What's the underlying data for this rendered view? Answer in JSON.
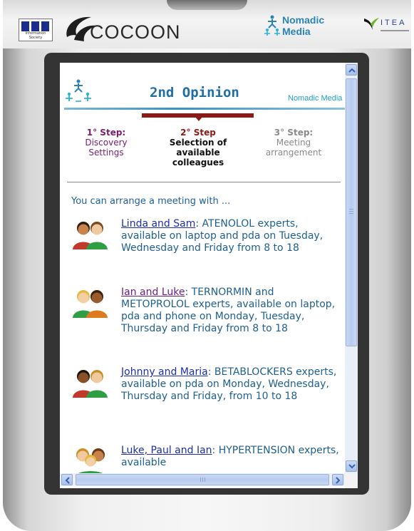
{
  "branding": {
    "info_society_caption": "Information Society",
    "cocoon_wordmark": "COCOON",
    "nomadic_media": [
      "Nomadic",
      "Media"
    ],
    "itea": "ITEA"
  },
  "banner": {
    "title": "2nd Opinion",
    "brand": "Nomadic Media"
  },
  "steps": [
    {
      "num": "1° Step:",
      "text": "Discovery Settings"
    },
    {
      "num": "2° Step",
      "text": "Selection of available colleagues"
    },
    {
      "num": "3° Step:",
      "text": "Meeting arrangement"
    }
  ],
  "active_step": 2,
  "intro": "You can arrange a meeting with ...",
  "groups": [
    {
      "name": "Linda and Sam",
      "details": ": ATENOLOL experts, available on laptop and pda on Tuesday, Wednesday and Friday from 8 to 18"
    },
    {
      "name": "Ian and Luke",
      "details": ": TERNORMIN and METOPROLOL experts, available on laptop, pda and phone on Monday, Tuesday, Thursday and Friday from 8 to 18"
    },
    {
      "name": "Johnny and Maria",
      "details": ": BETABLOCKERS experts, available on pda on Monday, Wednesday, Thursday and Friday, from 10 to 18"
    },
    {
      "name": "Luke, Paul and Ian",
      "details": ": HYPERTENSION experts, available"
    }
  ],
  "icons": {
    "avatar": "two-people-icon",
    "scroll_up": "chevron-up-icon",
    "scroll_down": "chevron-down-icon",
    "scroll_left": "chevron-left-icon",
    "scroll_right": "chevron-right-icon"
  },
  "colors": {
    "title": "#1f6fa6",
    "active_step": "#8e1a16",
    "link": "#1c2fa6",
    "visited_link": "#6b1e86",
    "body_text": "#1f6090"
  }
}
